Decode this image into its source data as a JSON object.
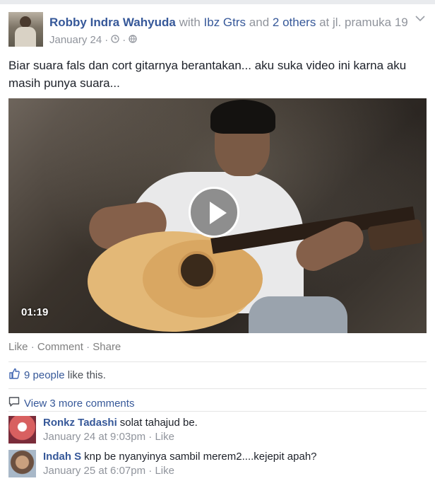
{
  "post": {
    "author": "Robby Indra Wahyuda",
    "with_word": "with",
    "tagged_friend": "Ibz Gtrs",
    "and_word": "and",
    "others": "2 others",
    "at_word": "at",
    "location": "jl. pramuka 19",
    "date": "January 24",
    "sep": "·",
    "text": "Biar suara fals dan cort gitarnya berantakan... aku suka video ini karna aku masih punya suara...",
    "video_duration": "01:19",
    "icons": {
      "privacy": "clock-icon",
      "audience": "globe-icon",
      "menu": "chevron-down-icon",
      "play": "play-icon",
      "like": "thumbs-up-icon",
      "comments": "comment-icon"
    }
  },
  "actions": {
    "like": "Like",
    "comment": "Comment",
    "share": "Share",
    "sep": " · "
  },
  "likes": {
    "count_text": "9 people",
    "suffix": "like this."
  },
  "comments": {
    "view_more": "View 3 more comments",
    "items": [
      {
        "name": "Ronkz Tadashi",
        "text": "solat tahajud be.",
        "timestamp": "January 24 at 9:03pm",
        "like": "Like"
      },
      {
        "name": "Indah S",
        "text": "knp be nyanyinya sambil merem2....kejepit apah?",
        "timestamp": "January 25 at 6:07pm",
        "like": "Like"
      }
    ]
  }
}
